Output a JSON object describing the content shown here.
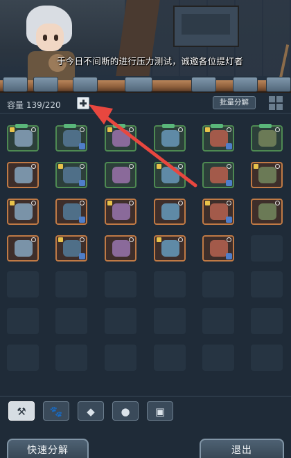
{
  "banner": {
    "dialogue": "于今日不间断的进行压力测试，诚邀各位提灯者"
  },
  "inventory": {
    "capacity_label": "容量 139/220",
    "batch_decompose_label": "批量分解"
  },
  "grid": {
    "rows": [
      [
        "green",
        "green",
        "green",
        "green",
        "green",
        "green"
      ],
      [
        "orange",
        "green",
        "green",
        "green",
        "green",
        "orange"
      ],
      [
        "orange",
        "orange",
        "orange",
        "orange",
        "orange",
        "orange"
      ],
      [
        "orange",
        "orange",
        "orange",
        "orange",
        "orange",
        "empty"
      ],
      [
        "empty",
        "empty",
        "empty",
        "empty",
        "empty",
        "empty"
      ],
      [
        "empty",
        "empty",
        "empty",
        "empty",
        "empty",
        "empty"
      ],
      [
        "empty",
        "empty",
        "empty",
        "empty",
        "empty",
        "empty"
      ]
    ]
  },
  "tabs": [
    {
      "icon": "equipment-icon",
      "glyph": "⚒",
      "active": true
    },
    {
      "icon": "paw-icon",
      "glyph": "🐾",
      "active": false
    },
    {
      "icon": "gem-icon",
      "glyph": "◆",
      "active": false
    },
    {
      "icon": "ore-icon",
      "glyph": "●",
      "active": false
    },
    {
      "icon": "chest-icon",
      "glyph": "▣",
      "active": false
    }
  ],
  "buttons": {
    "quick_decompose": "快速分解",
    "exit": "退出"
  },
  "colors": {
    "rarity_green": "#4e8a52",
    "rarity_orange": "#c07a45",
    "annotation_arrow": "#e8473f"
  }
}
